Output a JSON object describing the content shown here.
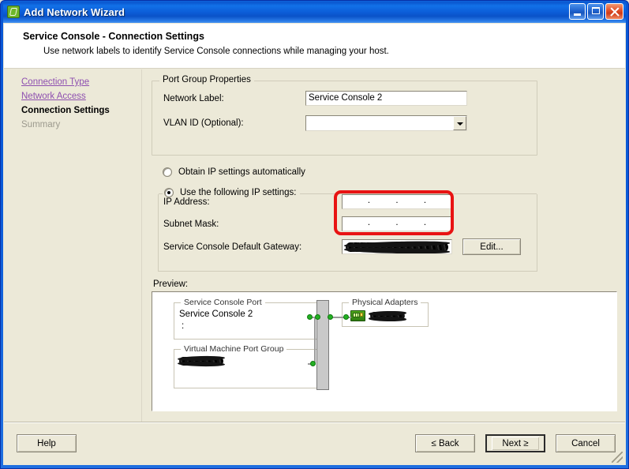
{
  "window": {
    "title": "Add Network Wizard",
    "icon": "network-wizard-icon",
    "minimize_label": "Minimize",
    "maximize_label": "Maximize",
    "close_label": "Close"
  },
  "header": {
    "title": "Service Console - Connection Settings",
    "subtitle": "Use network labels to identify Service Console connections while managing your host."
  },
  "sidebar": {
    "items": [
      {
        "label": "Connection Type",
        "state": "link"
      },
      {
        "label": "Network Access",
        "state": "link"
      },
      {
        "label": "Connection Settings",
        "state": "current"
      },
      {
        "label": "Summary",
        "state": "pending"
      }
    ]
  },
  "port_group": {
    "legend": "Port Group Properties",
    "network_label_label": "Network Label:",
    "network_label_value": "Service Console 2",
    "vlan_label": "VLAN ID (Optional):",
    "vlan_value": ""
  },
  "ip_settings": {
    "auto_label": "Obtain IP settings automatically",
    "auto_selected": false,
    "manual_label": "Use the following IP settings:",
    "manual_selected": true,
    "ip_address_label": "IP Address:",
    "ip_address_value": "",
    "subnet_mask_label": "Subnet Mask:",
    "subnet_mask_value": "",
    "gateway_label": "Service Console Default Gateway:",
    "gateway_value": "[redacted]",
    "edit_button": "Edit...",
    "octet_separator": ".",
    "annotation_color": "#E81313"
  },
  "preview": {
    "label": "Preview:",
    "service_console_port": {
      "legend": "Service Console Port",
      "name": "Service Console 2",
      "detail": ":"
    },
    "vm_port_group": {
      "legend": "Virtual Machine Port Group",
      "name": "[redacted]"
    },
    "physical_adapters": {
      "legend": "Physical Adapters",
      "adapter_name": "[redacted]"
    }
  },
  "footer": {
    "help": "Help",
    "back": "≤ Back",
    "next": "Next ≥",
    "cancel": "Cancel"
  },
  "colors": {
    "dialog_background": "#ECE9D8",
    "titlebar_blue": "#0A57D4",
    "link_purple": "#8E4FB0",
    "annotation_red": "#E81313",
    "node_green": "#23B023"
  }
}
